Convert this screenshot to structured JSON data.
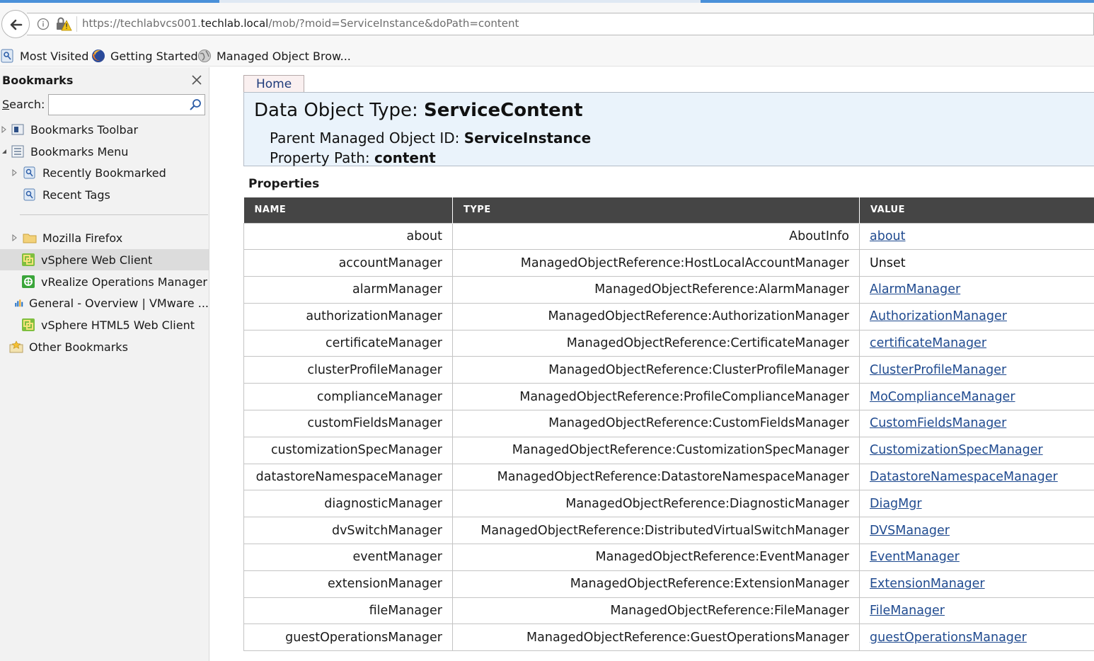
{
  "browser": {
    "url_prefix": "https://techlabvcs001.",
    "url_host": "techlab.local",
    "url_path": "/mob/?moid=ServiceInstance&doPath=content"
  },
  "bookmarks_toolbar": {
    "items": [
      {
        "label": "Most Visited"
      },
      {
        "label": "Getting Started"
      },
      {
        "label": "Managed Object Brow..."
      }
    ]
  },
  "sidebar": {
    "title": "Bookmarks",
    "search_label_accel": "S",
    "search_label_rest": "earch:",
    "search_value": "",
    "tree": [
      {
        "label": "Bookmarks Toolbar"
      },
      {
        "label": "Bookmarks Menu"
      },
      {
        "label": "Recently Bookmarked"
      },
      {
        "label": "Recent Tags"
      },
      {
        "label": "Mozilla Firefox"
      },
      {
        "label": "vSphere Web Client"
      },
      {
        "label": "vRealize Operations Manager"
      },
      {
        "label": "General - Overview | VMware ..."
      },
      {
        "label": "vSphere HTML5 Web Client"
      },
      {
        "label": "Other Bookmarks"
      }
    ]
  },
  "page": {
    "home_label": "Home",
    "header": {
      "type_label": "Data Object Type: ",
      "type_value": "ServiceContent",
      "parent_label": "Parent Managed Object ID: ",
      "parent_value": "ServiceInstance",
      "path_label": "Property Path: ",
      "path_value": "content"
    },
    "properties_title": "Properties",
    "columns": {
      "name": "NAME",
      "type": "TYPE",
      "value": "VALUE"
    },
    "rows": [
      {
        "name": "about",
        "type": "AboutInfo",
        "value": "about",
        "link": true
      },
      {
        "name": "accountManager",
        "type": "ManagedObjectReference:HostLocalAccountManager",
        "value": "Unset",
        "link": false
      },
      {
        "name": "alarmManager",
        "type": "ManagedObjectReference:AlarmManager",
        "value": "AlarmManager",
        "link": true
      },
      {
        "name": "authorizationManager",
        "type": "ManagedObjectReference:AuthorizationManager",
        "value": "AuthorizationManager",
        "link": true
      },
      {
        "name": "certificateManager",
        "type": "ManagedObjectReference:CertificateManager",
        "value": "certificateManager",
        "link": true
      },
      {
        "name": "clusterProfileManager",
        "type": "ManagedObjectReference:ClusterProfileManager",
        "value": "ClusterProfileManager",
        "link": true
      },
      {
        "name": "complianceManager",
        "type": "ManagedObjectReference:ProfileComplianceManager",
        "value": "MoComplianceManager",
        "link": true
      },
      {
        "name": "customFieldsManager",
        "type": "ManagedObjectReference:CustomFieldsManager",
        "value": "CustomFieldsManager",
        "link": true
      },
      {
        "name": "customizationSpecManager",
        "type": "ManagedObjectReference:CustomizationSpecManager",
        "value": "CustomizationSpecManager",
        "link": true
      },
      {
        "name": "datastoreNamespaceManager",
        "type": "ManagedObjectReference:DatastoreNamespaceManager",
        "value": "DatastoreNamespaceManager",
        "link": true
      },
      {
        "name": "diagnosticManager",
        "type": "ManagedObjectReference:DiagnosticManager",
        "value": "DiagMgr",
        "link": true
      },
      {
        "name": "dvSwitchManager",
        "type": "ManagedObjectReference:DistributedVirtualSwitchManager",
        "value": "DVSManager",
        "link": true
      },
      {
        "name": "eventManager",
        "type": "ManagedObjectReference:EventManager",
        "value": "EventManager",
        "link": true
      },
      {
        "name": "extensionManager",
        "type": "ManagedObjectReference:ExtensionManager",
        "value": "ExtensionManager",
        "link": true
      },
      {
        "name": "fileManager",
        "type": "ManagedObjectReference:FileManager",
        "value": "FileManager",
        "link": true
      },
      {
        "name": "guestOperationsManager",
        "type": "ManagedObjectReference:GuestOperationsManager",
        "value": "guestOperationsManager",
        "link": true
      }
    ]
  },
  "colors": {
    "link": "#1f4a8f",
    "table_header": "#454545",
    "header_box": "#eaf3fb"
  }
}
